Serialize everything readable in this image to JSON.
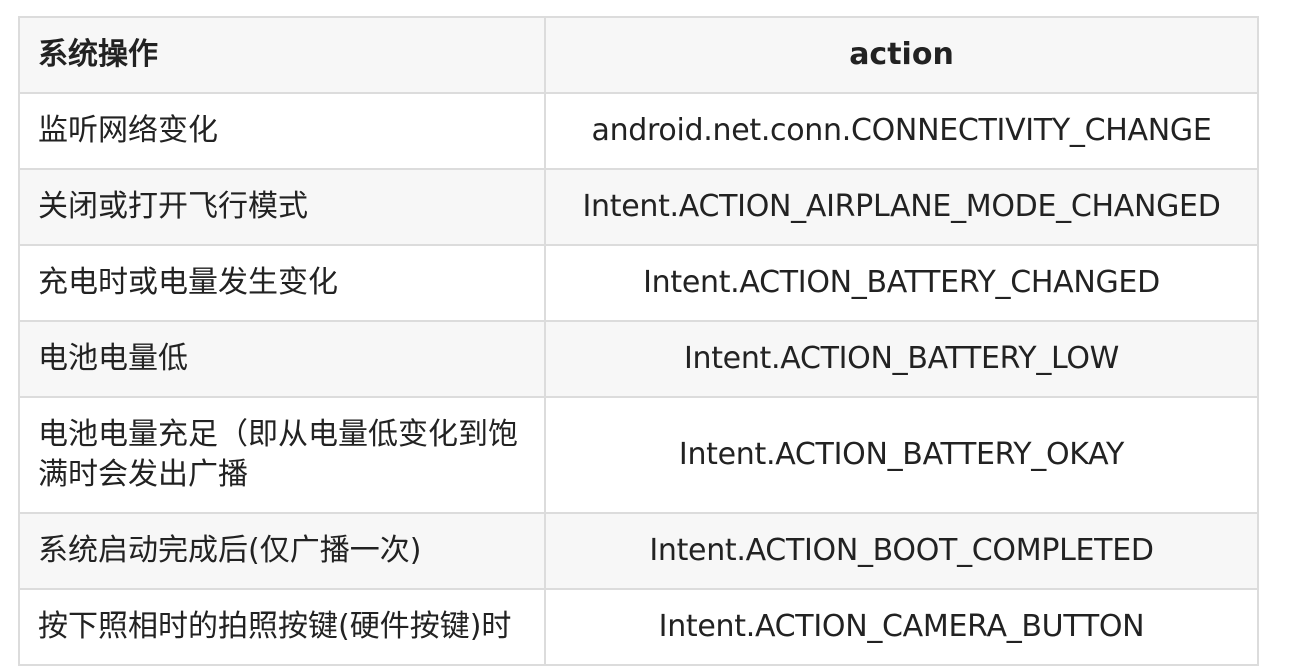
{
  "table": {
    "headers": [
      "系统操作",
      "action"
    ],
    "rows": [
      {
        "operation": "监听网络变化",
        "action": "android.net.conn.CONNECTIVITY_CHANGE"
      },
      {
        "operation": "关闭或打开飞行模式",
        "action": "Intent.ACTION_AIRPLANE_MODE_CHANGED"
      },
      {
        "operation": "充电时或电量发生变化",
        "action": "Intent.ACTION_BATTERY_CHANGED"
      },
      {
        "operation": "电池电量低",
        "action": "Intent.ACTION_BATTERY_LOW"
      },
      {
        "operation": "电池电量充足（即从电量低变化到饱满时会发出广播",
        "action": "Intent.ACTION_BATTERY_OKAY"
      },
      {
        "operation": "系统启动完成后(仅广播一次)",
        "action": "Intent.ACTION_BOOT_COMPLETED"
      },
      {
        "operation": "按下照相时的拍照按键(硬件按键)时",
        "action": "Intent.ACTION_CAMERA_BUTTON"
      }
    ]
  }
}
